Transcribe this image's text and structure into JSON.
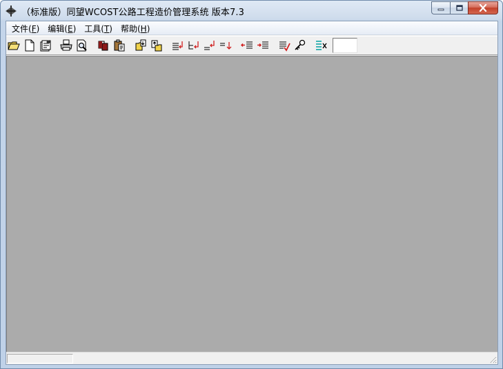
{
  "window": {
    "title": "（标准版）同望WCOST公路工程造价管理系统  版本7.3",
    "icon": "app-logo-icon",
    "controls": [
      "minimize-icon",
      "maximize-icon",
      "close-icon"
    ]
  },
  "menu": {
    "items": [
      {
        "name": "menu-file",
        "label": "文件(",
        "key": "F",
        "end": ")"
      },
      {
        "name": "menu-edit",
        "label": "编辑(",
        "key": "E",
        "end": ")"
      },
      {
        "name": "menu-tools",
        "label": "工具(",
        "key": "T",
        "end": ")"
      },
      {
        "name": "menu-help",
        "label": "帮助(",
        "key": "H",
        "end": ")"
      }
    ]
  },
  "toolbar": {
    "buttons": [
      "open-folder-icon",
      "new-document-icon",
      "properties-icon",
      "print-icon",
      "print-preview-icon",
      "copy-icon",
      "paste-icon",
      "import-icon",
      "export-icon",
      "insert-row-icon",
      "insert-child-icon",
      "insert-before-icon",
      "append-row-icon",
      "outdent-icon",
      "indent-icon",
      "check-icon",
      "search-key-icon",
      "clear-format-icon"
    ],
    "input_value": ""
  },
  "status": {
    "pane_text": ""
  }
}
